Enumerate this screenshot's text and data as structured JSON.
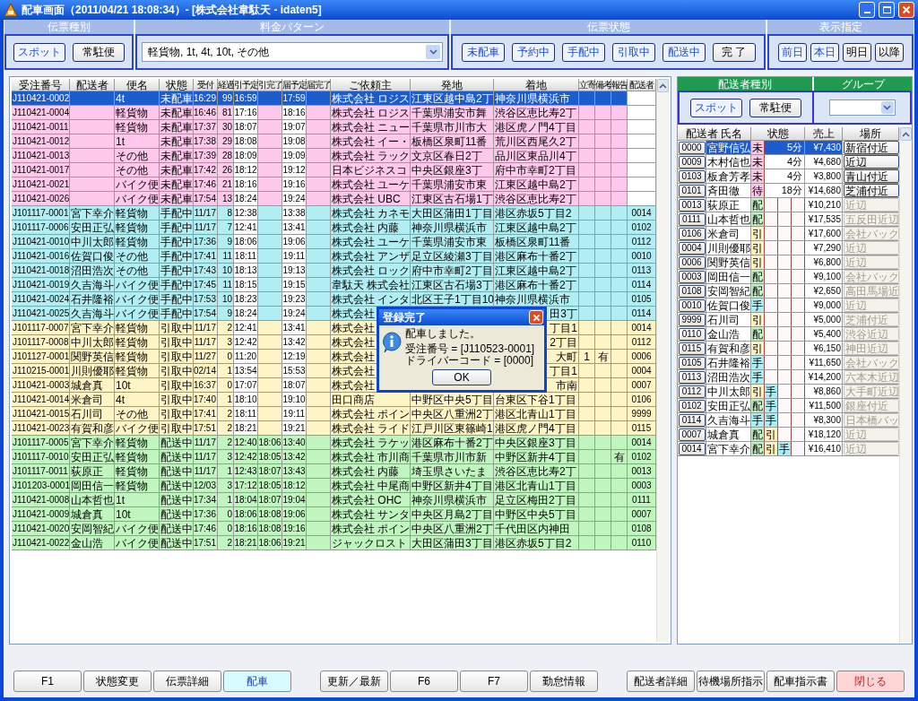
{
  "window": {
    "title": "配車画面（2011/04/21 18:08:34）- [株式会社韋駄天 - idaten5]"
  },
  "filters": [
    {
      "heading": "伝票種別",
      "kind": "buttons",
      "buttons": [
        {
          "label": "スポット",
          "selected": true
        },
        {
          "label": "常駐便",
          "selected": false
        }
      ]
    },
    {
      "heading": "料金パターン",
      "kind": "select",
      "value": "軽貨物, 1t, 4t, 10t, その他"
    },
    {
      "heading": "伝票状態",
      "kind": "buttons",
      "buttons": [
        {
          "label": "未配車",
          "selected": true
        },
        {
          "label": "予約中",
          "selected": true
        },
        {
          "label": "手配中",
          "selected": true
        },
        {
          "label": "引取中",
          "selected": true
        },
        {
          "label": "配送中",
          "selected": true
        },
        {
          "label": "完 了",
          "selected": false
        }
      ]
    },
    {
      "heading": "表示指定",
      "kind": "buttons",
      "buttons": [
        {
          "label": "前日",
          "selected": true
        },
        {
          "label": "本日",
          "selected": true
        },
        {
          "label": "明日",
          "selected": false
        },
        {
          "label": "以降",
          "selected": false
        }
      ]
    }
  ],
  "table": {
    "columns": [
      "受注番号",
      "配送者",
      "便名",
      "状態",
      "受付",
      "経過",
      "引予定",
      "引完了",
      "届予定",
      "届完了",
      "ご依頼主",
      "発地",
      "着地",
      "立寄",
      "備考",
      "報告",
      "配送者"
    ],
    "rows": [
      {
        "kind": "unassigned",
        "selected": true,
        "order_no": "J110421-0002",
        "service": "4t",
        "status": "未配車",
        "received": "16:29",
        "elapsed": "99",
        "pickup_due": "16:59",
        "delivery_due": "17:59",
        "client": "株式会社 ロジス",
        "origin": "江東区越中島2丁",
        "destination": "神奈川県横浜市"
      },
      {
        "kind": "unassigned",
        "selected": false,
        "order_no": "J110421-0004",
        "service": "軽貨物",
        "status": "未配車",
        "received": "16:46",
        "elapsed": "81",
        "pickup_due": "17:16",
        "delivery_due": "18:16",
        "client": "株式会社 ロジス",
        "origin": "千葉県浦安市舞",
        "destination": "渋谷区恵比寿2丁"
      },
      {
        "kind": "unassigned",
        "selected": false,
        "order_no": "J110421-0011",
        "service": "軽貨物",
        "status": "未配車",
        "received": "17:37",
        "elapsed": "30",
        "pickup_due": "18:07",
        "delivery_due": "19:07",
        "client": "株式会社 ニュー",
        "origin": "千葉県市川市大",
        "destination": "港区虎ノ門4丁目"
      },
      {
        "kind": "unassigned",
        "selected": false,
        "order_no": "J110421-0012",
        "service": "1t",
        "status": "未配車",
        "received": "17:38",
        "elapsed": "29",
        "pickup_due": "18:08",
        "delivery_due": "19:08",
        "client": "株式会社 イー・",
        "origin": "板橋区泉町11番",
        "destination": "荒川区西尾久2丁"
      },
      {
        "kind": "unassigned",
        "selected": false,
        "order_no": "J110421-0013",
        "service": "その他",
        "status": "未配車",
        "received": "17:39",
        "elapsed": "28",
        "pickup_due": "18:09",
        "delivery_due": "19:09",
        "client": "株式会社 ラック",
        "origin": "文京区春日2丁",
        "destination": "品川区東品川4丁"
      },
      {
        "kind": "unassigned",
        "selected": false,
        "order_no": "J110421-0017",
        "service": "その他",
        "status": "未配車",
        "received": "17:42",
        "elapsed": "26",
        "pickup_due": "18:12",
        "delivery_due": "19:12",
        "client": "日本ビジネスコ",
        "origin": "中央区銀座3丁",
        "destination": "府中市幸町2丁目"
      },
      {
        "kind": "unassigned",
        "selected": false,
        "order_no": "J110421-0021",
        "service": "バイク便",
        "status": "未配車",
        "received": "17:46",
        "elapsed": "21",
        "pickup_due": "18:16",
        "delivery_due": "19:16",
        "client": "株式会社 ユーケ",
        "origin": "千葉県浦安市東",
        "destination": "江東区越中島2丁"
      },
      {
        "kind": "unassigned",
        "selected": false,
        "order_no": "J110421-0026",
        "service": "バイク便",
        "status": "未配車",
        "received": "17:54",
        "elapsed": "13",
        "pickup_due": "18:24",
        "delivery_due": "19:24",
        "client": "株式会社 UBC",
        "origin": "江東区古石場1丁",
        "destination": "渋谷区恵比寿2丁"
      },
      {
        "kind": "arranging",
        "selected": false,
        "order_no": "J101117-0001",
        "driver": "宮下幸介",
        "service": "軽貨物",
        "status": "手配中",
        "received": "11/17",
        "elapsed": "8",
        "pickup_due": "12:38",
        "delivery_due": "13:38",
        "client": "株式会社 カネモ",
        "origin": "大田区蒲田1丁目",
        "destination": "港区赤坂5丁目2",
        "driver_code": "0014"
      },
      {
        "kind": "arranging",
        "selected": false,
        "order_no": "J101117-0006",
        "driver": "安田正弘",
        "service": "軽貨物",
        "status": "手配中",
        "received": "11/17",
        "elapsed": "7",
        "pickup_due": "12:41",
        "delivery_due": "13:41",
        "client": "株式会社 内藤",
        "origin": "神奈川県横浜市",
        "destination": "江東区越中島2丁",
        "driver_code": "0102"
      },
      {
        "kind": "arranging",
        "selected": false,
        "order_no": "J110421-0010",
        "driver": "中川太郎",
        "service": "軽貨物",
        "status": "手配中",
        "received": "17:36",
        "elapsed": "9",
        "pickup_due": "18:06",
        "delivery_due": "19:06",
        "client": "株式会社 ユーケ",
        "origin": "千葉県浦安市東",
        "destination": "板橋区泉町11番",
        "driver_code": "0112"
      },
      {
        "kind": "arranging",
        "selected": false,
        "order_no": "J110421-0016",
        "driver": "佐賀口俊",
        "service": "その他",
        "status": "手配中",
        "received": "17:41",
        "elapsed": "11",
        "pickup_due": "18:11",
        "delivery_due": "19:11",
        "client": "株式会社 アンザ",
        "origin": "足立区綾瀬3丁目",
        "destination": "港区麻布十番2丁",
        "driver_code": "0010"
      },
      {
        "kind": "arranging",
        "selected": false,
        "order_no": "J110421-0018",
        "driver": "沼田浩次",
        "service": "その他",
        "status": "手配中",
        "received": "17:43",
        "elapsed": "10",
        "pickup_due": "18:13",
        "delivery_due": "19:13",
        "client": "株式会社 ロック",
        "origin": "府中市幸町2丁目",
        "destination": "江東区越中島2丁",
        "driver_code": "0113"
      },
      {
        "kind": "arranging",
        "selected": false,
        "order_no": "J110421-0019",
        "driver": "久吉海斗",
        "service": "バイク便",
        "status": "手配中",
        "received": "17:45",
        "elapsed": "11",
        "pickup_due": "18:15",
        "delivery_due": "19:15",
        "client": "韋駄天 株式会社",
        "origin": "江東区古石場3丁",
        "destination": "港区麻布十番2丁",
        "driver_code": "0114"
      },
      {
        "kind": "arranging",
        "selected": false,
        "order_no": "J110421-0024",
        "driver": "石井隆裕",
        "service": "バイク便",
        "status": "手配中",
        "received": "17:53",
        "elapsed": "10",
        "pickup_due": "18:23",
        "delivery_due": "19:23",
        "client": "株式会社 インタ",
        "origin": "北区王子1丁目10",
        "destination": "神奈川県横浜市",
        "driver_code": "0105"
      },
      {
        "kind": "arranging",
        "selected": false,
        "order_no": "J110421-0025",
        "driver": "久吉海斗",
        "service": "バイク便",
        "status": "手配中",
        "received": "17:54",
        "elapsed": "9",
        "pickup_due": "18:24",
        "delivery_due": "19:24",
        "client": "株式会社",
        "destination": "田3丁",
        "destination_clipped": true,
        "driver_code": "0114"
      },
      {
        "kind": "pickup",
        "selected": false,
        "order_no": "J101117-0007",
        "driver": "宮下幸介",
        "service": "軽貨物",
        "status": "引取中",
        "received": "11/17",
        "elapsed": "2",
        "pickup_due": "12:41",
        "delivery_due": "13:41",
        "client": "株式会社",
        "destination": "丁目1",
        "destination_clipped": true,
        "driver_code": "0014"
      },
      {
        "kind": "pickup",
        "selected": false,
        "order_no": "J101117-0008",
        "driver": "中川太郎",
        "service": "軽貨物",
        "status": "引取中",
        "received": "11/17",
        "elapsed": "3",
        "pickup_due": "12:42",
        "delivery_due": "13:42",
        "client": "株式会社",
        "destination": "2丁目",
        "destination_clipped": true,
        "driver_code": "0112"
      },
      {
        "kind": "pickup",
        "selected": false,
        "order_no": "J101127-0001",
        "driver": "関野英信",
        "service": "軽貨物",
        "status": "引取中",
        "received": "11/27",
        "elapsed": "0",
        "pickup_due": "11:20",
        "delivery_due": "12:19",
        "client": "株式会社",
        "destination": "大町",
        "destination_clipped": true,
        "stop": "1",
        "note": "有",
        "driver_code": "0006"
      },
      {
        "kind": "pickup",
        "selected": false,
        "order_no": "J110215-0001",
        "driver": "川則優耶",
        "service": "軽貨物",
        "status": "引取中",
        "received": "02/14",
        "elapsed": "1",
        "pickup_due": "13:54",
        "delivery_due": "15:53",
        "client": "株式会社",
        "destination": "丁目1",
        "destination_clipped": true,
        "driver_code": "0004"
      },
      {
        "kind": "pickup",
        "selected": false,
        "order_no": "J110421-0003",
        "driver": "城倉真",
        "service": "10t",
        "status": "引取中",
        "received": "16:37",
        "elapsed": "0",
        "pickup_due": "17:07",
        "delivery_due": "18:07",
        "client": "株式会社",
        "destination": "市南",
        "destination_clipped": true,
        "driver_code": "0007"
      },
      {
        "kind": "pickup",
        "selected": false,
        "order_no": "J110421-0014",
        "driver": "米倉司",
        "service": "4t",
        "status": "引取中",
        "received": "17:40",
        "elapsed": "1",
        "pickup_due": "18:10",
        "delivery_due": "19:10",
        "client": "田口商店",
        "origin": "中野区中央5丁目",
        "destination": "台東区下谷1丁目",
        "driver_code": "0106"
      },
      {
        "kind": "pickup",
        "selected": false,
        "order_no": "J110421-0015",
        "driver": "石川司",
        "service": "その他",
        "status": "引取中",
        "received": "17:41",
        "elapsed": "2",
        "pickup_due": "18:11",
        "delivery_due": "19:11",
        "client": "株式会社 ポイン",
        "origin": "中央区八重洲2丁",
        "destination": "港区北青山1丁目",
        "driver_code": "9999"
      },
      {
        "kind": "pickup",
        "selected": false,
        "order_no": "J110421-0023",
        "driver": "有賀和彦",
        "service": "バイク便",
        "status": "引取中",
        "received": "17:51",
        "elapsed": "2",
        "pickup_due": "18:21",
        "delivery_due": "19:21",
        "client": "株式会社 ライド",
        "origin": "江戸川区東篠崎1",
        "destination": "港区虎ノ門4丁目",
        "driver_code": "0115"
      },
      {
        "kind": "delivering",
        "selected": false,
        "order_no": "J101117-0005",
        "driver": "宮下幸介",
        "service": "軽貨物",
        "status": "配送中",
        "received": "11/17",
        "elapsed": "2",
        "pickup_due": "12:40",
        "pickup_done": "18:06",
        "delivery_due": "13:40",
        "client": "株式会社 ラケッ",
        "origin": "港区麻布十番2丁",
        "destination": "中央区銀座3丁目",
        "driver_code": "0014"
      },
      {
        "kind": "delivering",
        "selected": false,
        "order_no": "J101117-0010",
        "driver": "安田正弘",
        "service": "軽貨物",
        "status": "配送中",
        "received": "11/17",
        "elapsed": "3",
        "pickup_due": "12:42",
        "pickup_done": "18:05",
        "delivery_due": "13:42",
        "client": "株式会社 市川商",
        "origin": "千葉県市川市新",
        "destination": "中野区新井4丁目",
        "report": "有",
        "driver_code": "0102"
      },
      {
        "kind": "delivering",
        "selected": false,
        "order_no": "J101117-0011",
        "driver": "荻原正",
        "service": "軽貨物",
        "status": "配送中",
        "received": "11/17",
        "elapsed": "1",
        "pickup_due": "12:43",
        "pickup_done": "18:07",
        "delivery_due": "13:43",
        "client": "株式会社 内藤",
        "origin": "埼玉県さいたま",
        "destination": "渋谷区恵比寿2丁",
        "driver_code": "0013"
      },
      {
        "kind": "delivering",
        "selected": false,
        "order_no": "J101203-0001",
        "driver": "岡田信一",
        "service": "軽貨物",
        "status": "配送中",
        "received": "12/03",
        "elapsed": "3",
        "pickup_due": "17:12",
        "pickup_done": "18:05",
        "delivery_due": "18:12",
        "client": "株式会社 中尾商",
        "origin": "中野区新井4丁目",
        "destination": "港区北青山1丁目",
        "driver_code": "0003"
      },
      {
        "kind": "delivering",
        "selected": false,
        "order_no": "J110421-0008",
        "driver": "山本哲也",
        "service": "1t",
        "status": "配送中",
        "received": "17:34",
        "elapsed": "1",
        "pickup_due": "18:04",
        "pickup_done": "18:07",
        "delivery_due": "19:04",
        "client": "株式会社 OHC",
        "origin": "神奈川県横浜市",
        "destination": "足立区梅田2丁目",
        "driver_code": "0111"
      },
      {
        "kind": "delivering",
        "selected": false,
        "order_no": "J110421-0009",
        "driver": "城倉真",
        "service": "10t",
        "status": "配送中",
        "received": "17:36",
        "elapsed": "0",
        "pickup_due": "18:06",
        "pickup_done": "18:08",
        "delivery_due": "19:06",
        "client": "株式会社 サンタ",
        "origin": "中央区月島2丁目",
        "destination": "中野区中央5丁目",
        "driver_code": "0007"
      },
      {
        "kind": "delivering",
        "selected": false,
        "order_no": "J110421-0020",
        "driver": "安岡智紀",
        "service": "バイク便",
        "status": "配送中",
        "received": "17:46",
        "elapsed": "0",
        "pickup_due": "18:16",
        "pickup_done": "18:08",
        "delivery_due": "19:16",
        "client": "株式会社 ポイン",
        "origin": "中央区八重洲2丁",
        "destination": "千代田区内神田",
        "driver_code": "0108"
      },
      {
        "kind": "delivering",
        "selected": false,
        "order_no": "J110421-0022",
        "driver": "金山浩",
        "service": "バイク便",
        "status": "配送中",
        "received": "17:51",
        "elapsed": "2",
        "pickup_due": "18:21",
        "pickup_done": "18:06",
        "delivery_due": "19:21",
        "client": "ジャックロスト",
        "origin": "大田区蒲田3丁目",
        "destination": "港区赤坂5丁目2",
        "driver_code": "0110"
      }
    ]
  },
  "driver_panel": {
    "headings": [
      "配送者種別",
      "グループ"
    ],
    "type_buttons": [
      {
        "label": "スポット",
        "selected": true
      },
      {
        "label": "常駐便",
        "selected": false
      }
    ],
    "columns": [
      "配送者 氏名",
      "状態",
      "売上",
      "場所"
    ],
    "drivers": [
      {
        "code": "0000",
        "name": "宮野信弘",
        "statuses": [
          {
            "label": "未",
            "kind": "unassigned"
          }
        ],
        "wait": "5分",
        "sales": "¥7,430",
        "place": "新宿付近",
        "disabled": false,
        "selected": true
      },
      {
        "code": "0009",
        "name": "木村信也",
        "statuses": [
          {
            "label": "未",
            "kind": "unassigned"
          }
        ],
        "wait": "4分",
        "sales": "¥4,680",
        "place": "近辺",
        "disabled": false,
        "selected": false
      },
      {
        "code": "0103",
        "name": "板倉芳孝",
        "statuses": [
          {
            "label": "未",
            "kind": "unassigned"
          }
        ],
        "wait": "4分",
        "sales": "¥3,800",
        "place": "青山付近",
        "disabled": false,
        "selected": false
      },
      {
        "code": "0101",
        "name": "斉田徹",
        "statuses": [
          {
            "label": "待",
            "kind": "waiting"
          }
        ],
        "wait": "18分",
        "sales": "¥14,680",
        "place": "芝浦付近",
        "disabled": false,
        "selected": false
      },
      {
        "code": "0013",
        "name": "荻原正",
        "statuses": [
          {
            "label": "配",
            "kind": "delivering"
          }
        ],
        "sales": "¥10,210",
        "place": "近辺",
        "disabled": true,
        "selected": false
      },
      {
        "code": "0111",
        "name": "山本哲也",
        "statuses": [
          {
            "label": "配",
            "kind": "delivering"
          }
        ],
        "sales": "¥17,535",
        "place": "五反田近辺",
        "disabled": true,
        "selected": false
      },
      {
        "code": "0106",
        "name": "米倉司",
        "statuses": [
          {
            "label": "引",
            "kind": "pickup"
          }
        ],
        "sales": "¥17,600",
        "place": "会社バック",
        "disabled": true,
        "selected": false
      },
      {
        "code": "0004",
        "name": "川則優耶",
        "statuses": [
          {
            "label": "引",
            "kind": "pickup"
          }
        ],
        "sales": "¥7,290",
        "place": "近辺",
        "disabled": true,
        "selected": false
      },
      {
        "code": "0006",
        "name": "関野英信",
        "statuses": [
          {
            "label": "引",
            "kind": "pickup"
          }
        ],
        "sales": "¥6,800",
        "place": "近辺",
        "disabled": true,
        "selected": false
      },
      {
        "code": "0003",
        "name": "岡田信一",
        "statuses": [
          {
            "label": "配",
            "kind": "delivering"
          }
        ],
        "sales": "¥9,100",
        "place": "会社バック",
        "disabled": true,
        "selected": false
      },
      {
        "code": "0108",
        "name": "安岡智紀",
        "statuses": [
          {
            "label": "配",
            "kind": "delivering"
          }
        ],
        "sales": "¥2,650",
        "place": "高田馬場近",
        "disabled": true,
        "selected": false
      },
      {
        "code": "0010",
        "name": "佐賀口俊",
        "statuses": [
          {
            "label": "手",
            "kind": "arranging"
          }
        ],
        "sales": "¥9,000",
        "place": "近辺",
        "disabled": true,
        "selected": false
      },
      {
        "code": "9999",
        "name": "石川司",
        "statuses": [
          {
            "label": "引",
            "kind": "pickup"
          }
        ],
        "sales": "¥5,000",
        "place": "芝浦付近",
        "disabled": true,
        "selected": false
      },
      {
        "code": "0110",
        "name": "金山浩",
        "statuses": [
          {
            "label": "配",
            "kind": "delivering"
          }
        ],
        "sales": "¥5,400",
        "place": "渋谷近辺",
        "disabled": true,
        "selected": false
      },
      {
        "code": "0115",
        "name": "有賀和彦",
        "statuses": [
          {
            "label": "引",
            "kind": "pickup"
          }
        ],
        "sales": "¥6,150",
        "place": "神田近辺",
        "disabled": true,
        "selected": false
      },
      {
        "code": "0105",
        "name": "石井隆裕",
        "statuses": [
          {
            "label": "手",
            "kind": "arranging"
          }
        ],
        "sales": "¥11,650",
        "place": "会社バック",
        "disabled": true,
        "selected": false
      },
      {
        "code": "0113",
        "name": "沼田浩次",
        "statuses": [
          {
            "label": "手",
            "kind": "arranging"
          }
        ],
        "sales": "¥14,200",
        "place": "六本木近辺",
        "disabled": true,
        "selected": false
      },
      {
        "code": "0112",
        "name": "中川太郎",
        "statuses": [
          {
            "label": "引",
            "kind": "pickup"
          },
          {
            "label": "手",
            "kind": "arranging"
          }
        ],
        "sales": "¥8,860",
        "place": "大手町近辺",
        "disabled": true,
        "selected": false
      },
      {
        "code": "0102",
        "name": "安田正弘",
        "statuses": [
          {
            "label": "配",
            "kind": "delivering"
          },
          {
            "label": "手",
            "kind": "arranging"
          }
        ],
        "sales": "¥11,500",
        "place": "銀座付近",
        "disabled": true,
        "selected": false
      },
      {
        "code": "0114",
        "name": "久吉海斗",
        "statuses": [
          {
            "label": "手",
            "kind": "arranging"
          },
          {
            "label": "手",
            "kind": "arranging"
          }
        ],
        "sales": "¥8,300",
        "place": "日本橋バッ",
        "disabled": true,
        "selected": false
      },
      {
        "code": "0007",
        "name": "城倉真",
        "statuses": [
          {
            "label": "配",
            "kind": "delivering"
          },
          {
            "label": "引",
            "kind": "pickup"
          }
        ],
        "sales": "¥18,120",
        "place": "近辺",
        "disabled": true,
        "selected": false
      },
      {
        "code": "0014",
        "name": "宮下幸介",
        "statuses": [
          {
            "label": "配",
            "kind": "delivering"
          },
          {
            "label": "引",
            "kind": "pickup"
          },
          {
            "label": "手",
            "kind": "arranging"
          }
        ],
        "sales": "¥16,410",
        "place": "近辺",
        "disabled": true,
        "selected": false
      }
    ]
  },
  "dialog": {
    "title": "登録完了",
    "lines": [
      "配車しました。",
      "受注番号 = [J110523-0001]",
      "ドライバーコード = [0000]"
    ],
    "button": "OK"
  },
  "footer": {
    "groups": [
      [
        {
          "label": "F1",
          "kind": "normal"
        },
        {
          "label": "状態変更",
          "kind": "normal"
        },
        {
          "label": "伝票詳細",
          "kind": "normal"
        },
        {
          "label": "配車",
          "kind": "primary"
        }
      ],
      [
        {
          "label": "更新／最新",
          "kind": "normal"
        },
        {
          "label": "F6",
          "kind": "normal"
        },
        {
          "label": "F7",
          "kind": "normal"
        },
        {
          "label": "勤怠情報",
          "kind": "normal"
        }
      ],
      [
        {
          "label": "配送者詳細",
          "kind": "normal"
        },
        {
          "label": "待機場所指示",
          "kind": "normal"
        },
        {
          "label": "配車指示書",
          "kind": "normal"
        },
        {
          "label": "閉じる",
          "kind": "danger"
        }
      ]
    ]
  }
}
